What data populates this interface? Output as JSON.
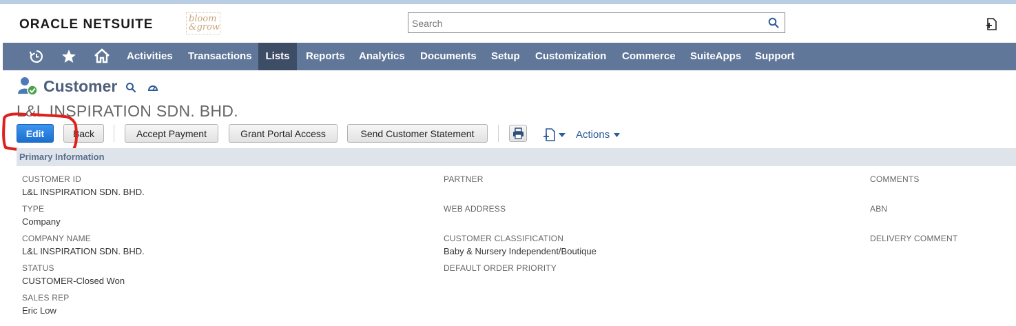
{
  "header": {
    "logo_primary": "ORACLE",
    "logo_secondary": "NETSUITE",
    "brand_logo_text": "bloom & grow",
    "search_placeholder": "Search"
  },
  "nav": {
    "items": [
      {
        "label": "Activities"
      },
      {
        "label": "Transactions"
      },
      {
        "label": "Lists",
        "active": true
      },
      {
        "label": "Reports"
      },
      {
        "label": "Analytics"
      },
      {
        "label": "Documents"
      },
      {
        "label": "Setup"
      },
      {
        "label": "Customization"
      },
      {
        "label": "Commerce"
      },
      {
        "label": "SuiteApps"
      },
      {
        "label": "Support"
      }
    ]
  },
  "page": {
    "title": "Customer",
    "record_name": "L&L INSPIRATION SDN. BHD."
  },
  "toolbar": {
    "edit": "Edit",
    "back": "Back",
    "accept_payment": "Accept Payment",
    "grant_portal_access": "Grant Portal Access",
    "send_customer_statement": "Send Customer Statement",
    "actions": "Actions"
  },
  "section": {
    "title": "Primary Information"
  },
  "fields": {
    "customer_id": {
      "label": "CUSTOMER ID",
      "value": "L&L INSPIRATION SDN. BHD."
    },
    "type": {
      "label": "TYPE",
      "value": "Company"
    },
    "company_name": {
      "label": "COMPANY NAME",
      "value": "L&L INSPIRATION SDN. BHD."
    },
    "status": {
      "label": "STATUS",
      "value": "CUSTOMER-Closed Won"
    },
    "sales_rep": {
      "label": "SALES REP",
      "value": "Eric Low"
    },
    "partner": {
      "label": "PARTNER",
      "value": ""
    },
    "web_address": {
      "label": "WEB ADDRESS",
      "value": ""
    },
    "customer_classification": {
      "label": "CUSTOMER CLASSIFICATION",
      "value": "Baby & Nursery Independent/Boutique"
    },
    "default_order_priority": {
      "label": "DEFAULT ORDER PRIORITY",
      "value": ""
    },
    "comments": {
      "label": "COMMENTS",
      "value": ""
    },
    "abn": {
      "label": "ABN",
      "value": ""
    },
    "delivery_comment": {
      "label": "DELIVERY COMMENT",
      "value": ""
    }
  },
  "colors": {
    "nav_bg": "#607799",
    "nav_active": "#3d4d66",
    "primary_button": "#1a6fcf",
    "annotation": "#e0201b",
    "section_bg": "#dfe4eb"
  }
}
